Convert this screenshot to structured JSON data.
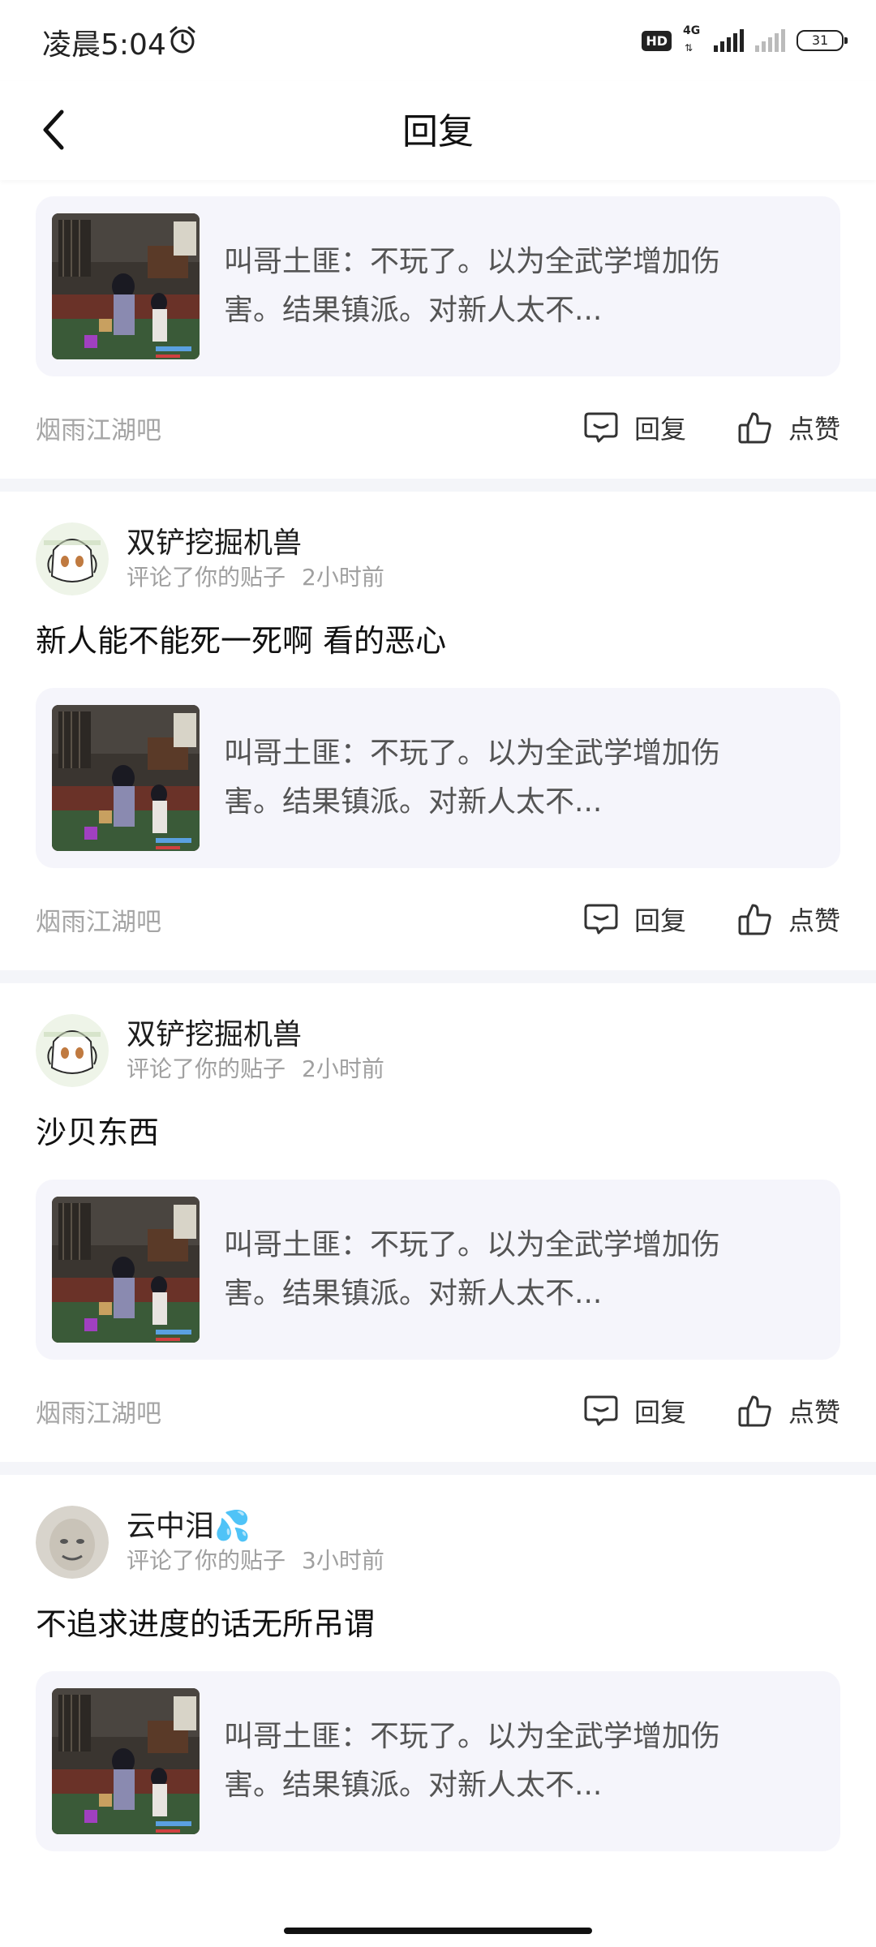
{
  "status": {
    "time": "凌晨5:04",
    "hd": "HD",
    "network": "4G",
    "battery": "31"
  },
  "nav": {
    "title": "回复"
  },
  "comments": [
    {
      "forum": "烟雨江湖吧",
      "post_preview": "叫哥土匪：不玩了。以为全武学增加伤害。结果镇派。对新人太不...",
      "reply_label": "回复",
      "like_label": "点赞"
    },
    {
      "user": "双铲挖掘机兽",
      "action": "评论了你的贴子",
      "time": "2小时前",
      "text": "新人能不能死一死啊 看的恶心",
      "post_preview": "叫哥土匪：不玩了。以为全武学增加伤害。结果镇派。对新人太不...",
      "forum": "烟雨江湖吧",
      "reply_label": "回复",
      "like_label": "点赞"
    },
    {
      "user": "双铲挖掘机兽",
      "action": "评论了你的贴子",
      "time": "2小时前",
      "text": "沙贝东西",
      "post_preview": "叫哥土匪：不玩了。以为全武学增加伤害。结果镇派。对新人太不...",
      "forum": "烟雨江湖吧",
      "reply_label": "回复",
      "like_label": "点赞"
    },
    {
      "user": "云中泪💦",
      "action": "评论了你的贴子",
      "time": "3小时前",
      "text": "不追求进度的话无所吊谓",
      "post_preview": "叫哥土匪：不玩了。以为全武学增加伤害。结果镇派。对新人太不..."
    }
  ],
  "colors": {
    "accent_bg": "#f5f5fb",
    "divider": "#f4f5f9",
    "muted": "#a0a0a0"
  }
}
